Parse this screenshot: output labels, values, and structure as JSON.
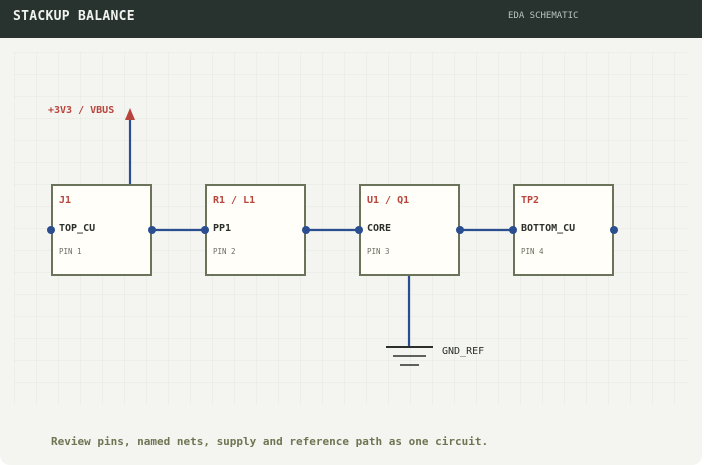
{
  "header": {
    "title": "STACKUP BALANCE",
    "subtitle": "EDA SCHEMATIC"
  },
  "supply": {
    "label": "+3V3 / VBUS"
  },
  "ground": {
    "label": "GND_REF"
  },
  "components": [
    {
      "ref": "J1",
      "net": "TOP_CU",
      "pin": "PIN 1"
    },
    {
      "ref": "R1 / L1",
      "net": "PP1",
      "pin": "PIN 2"
    },
    {
      "ref": "U1 / Q1",
      "net": "CORE",
      "pin": "PIN 3"
    },
    {
      "ref": "TP2",
      "net": "BOTTOM_CU",
      "pin": "PIN 4"
    }
  ],
  "caption": "Review pins, named nets, supply and reference path as one circuit.",
  "colors": {
    "wire": "#2a4e8f",
    "supply": "#b8453d",
    "component_border": "#6c735b",
    "component_fill": "#fffef8",
    "ref_text": "#b8453d"
  }
}
